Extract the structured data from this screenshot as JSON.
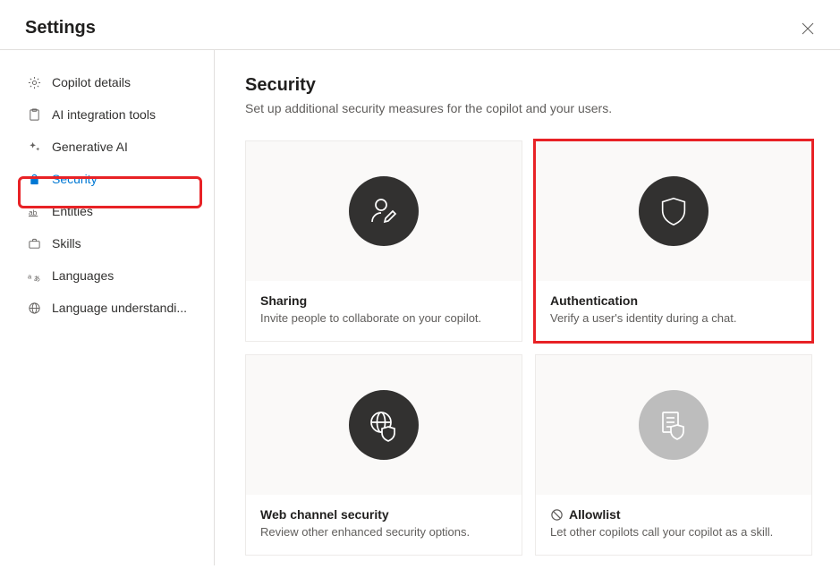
{
  "header": {
    "title": "Settings"
  },
  "sidebar": {
    "items": [
      {
        "label": "Copilot details"
      },
      {
        "label": "AI integration tools"
      },
      {
        "label": "Generative AI"
      },
      {
        "label": "Security"
      },
      {
        "label": "Entities"
      },
      {
        "label": "Skills"
      },
      {
        "label": "Languages"
      },
      {
        "label": "Language understandi..."
      }
    ]
  },
  "page": {
    "title": "Security",
    "subtitle": "Set up additional security measures for the copilot and your users."
  },
  "cards": [
    {
      "title": "Sharing",
      "desc": "Invite people to collaborate on your copilot."
    },
    {
      "title": "Authentication",
      "desc": "Verify a user's identity during a chat."
    },
    {
      "title": "Web channel security",
      "desc": "Review other enhanced security options."
    },
    {
      "title": "Allowlist",
      "desc": "Let other copilots call your copilot as a skill."
    }
  ]
}
